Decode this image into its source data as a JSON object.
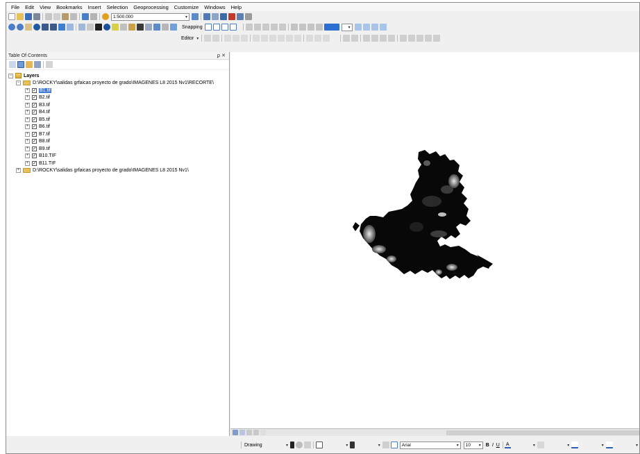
{
  "menu": [
    "File",
    "Edit",
    "View",
    "Bookmarks",
    "Insert",
    "Selection",
    "Geoprocessing",
    "Customize",
    "Windows",
    "Help"
  ],
  "toolbar": {
    "scale_value": "1:500.000",
    "snapping_label": "Snapping",
    "editor_label": "Editor"
  },
  "toc": {
    "title": "Table Of Contents",
    "root_label": "Layers",
    "group1_label": "D:\\ROCKY\\salidas grfaicas proyecto de grado\\IMAGENES L8 2015 Nv1\\RECORTE\\",
    "layers": [
      "B1.tif",
      "B2.tif",
      "B3.tif",
      "B4.tif",
      "B5.tif",
      "B6.tif",
      "B7.tif",
      "B8.tif",
      "B9.tif",
      "B10.TIF",
      "B11.TIF"
    ],
    "group2_label": "D:\\ROCKY\\salidas grfaicas proyecto de grado\\IMAGENES L8 2015 Nv1\\"
  },
  "drawing": {
    "label": "Drawing",
    "font_name": "Arial",
    "font_size": "10"
  },
  "icons": {
    "pin": "pin-icon",
    "close": "close-icon"
  },
  "colors": {
    "selection": "#3b78d8",
    "folder": "#e8c15a"
  }
}
